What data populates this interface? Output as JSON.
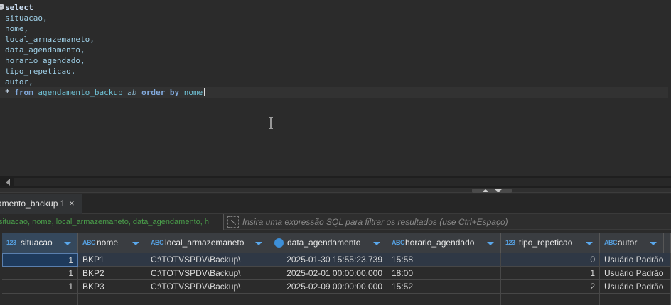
{
  "editor": {
    "line_marker": "-",
    "lines": [
      "select",
      "situacao,",
      "nome,",
      "local_armazemaneto,",
      "data_agendamento,",
      "horario_agendado,",
      "tipo_repeticao,",
      "autor,"
    ],
    "last_line": {
      "star": "*",
      "from": "from",
      "table": "agendamento_backup",
      "alias": "ab",
      "order_by": "order by",
      "col": "nome"
    }
  },
  "results": {
    "tab_label": "amento_backup 1",
    "close_icon": "×",
    "filter_columns": "situacao, nome, local_armazemaneto, data_agendamento, h",
    "filter_placeholder": "Insira uma expressão SQL para filtrar os resultados (use Ctrl+Espaço)"
  },
  "grid": {
    "columns": [
      {
        "type": "123",
        "name": "situacao"
      },
      {
        "type": "ABC",
        "name": "nome"
      },
      {
        "type": "ABC",
        "name": "local_armazemaneto"
      },
      {
        "type": "clock-icon",
        "name": "data_agendamento"
      },
      {
        "type": "ABC",
        "name": "horario_agendado"
      },
      {
        "type": "123",
        "name": "tipo_repeticao"
      },
      {
        "type": "ABC",
        "name": "autor"
      }
    ],
    "rows": [
      [
        "1",
        "BKP1",
        "C:\\TOTVSPDV\\Backup\\",
        "2025-01-30 15:55:23.739",
        "15:58",
        "0",
        "Usuário Padrão"
      ],
      [
        "1",
        "BKP2",
        "C:\\TOTVSPDV\\Backup\\",
        "2025-02-01 00:00:00.000",
        "18:00",
        "1",
        "Usuário Padrão"
      ],
      [
        "1",
        "BKP3",
        "C:\\TOTVSPDV\\Backup\\",
        "2025-02-09 00:00:00.000",
        "15:52",
        "2",
        "Usuário Padrão"
      ]
    ]
  },
  "colors": {
    "selection": "#1e3a5c",
    "header_first": "#35485c",
    "keyword": "#cfe2f7",
    "identifier": "#9fd0e8",
    "filter_text": "#4a9e4a"
  }
}
